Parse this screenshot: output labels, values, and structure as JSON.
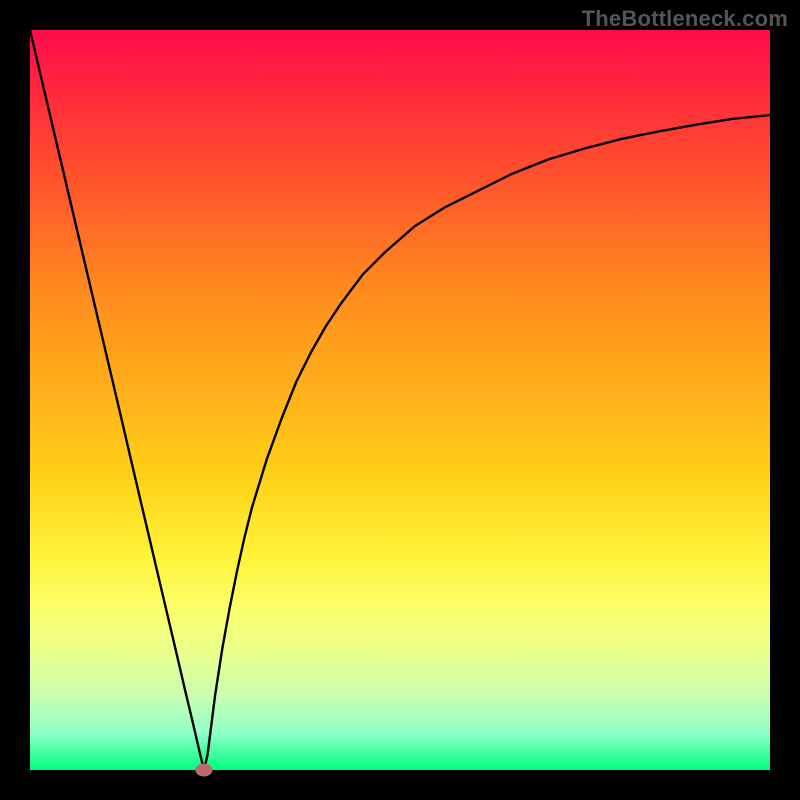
{
  "watermark": "TheBottleneck.com",
  "colors": {
    "curve_stroke": "#000000",
    "min_marker": "#be6a6a",
    "frame_background": "#000000"
  },
  "chart_data": {
    "type": "line",
    "title": "",
    "xlabel": "",
    "ylabel": "",
    "xlim": [
      0,
      100
    ],
    "ylim": [
      0,
      100
    ],
    "grid": false,
    "legend": false,
    "annotations": [],
    "minimum": {
      "x": 23.5,
      "y": 0
    },
    "x": [
      0,
      2,
      4,
      6,
      8,
      10,
      12,
      14,
      16,
      18,
      20,
      21,
      22,
      23,
      23.5,
      24,
      25,
      26,
      27,
      28,
      29,
      30,
      32,
      34,
      36,
      38,
      40,
      42,
      45,
      48,
      52,
      56,
      60,
      65,
      70,
      75,
      80,
      85,
      90,
      95,
      100
    ],
    "values": [
      100,
      91.5,
      83.0,
      74.5,
      66.0,
      57.5,
      49.0,
      40.4,
      31.9,
      23.4,
      14.9,
      10.6,
      6.4,
      2.1,
      0.0,
      2.1,
      10.0,
      16.5,
      22.0,
      27.0,
      31.5,
      35.5,
      42.0,
      47.5,
      52.5,
      56.5,
      60.0,
      63.0,
      67.0,
      70.0,
      73.5,
      76.0,
      78.0,
      80.5,
      82.5,
      84.0,
      85.3,
      86.3,
      87.2,
      88.0,
      88.5
    ]
  }
}
